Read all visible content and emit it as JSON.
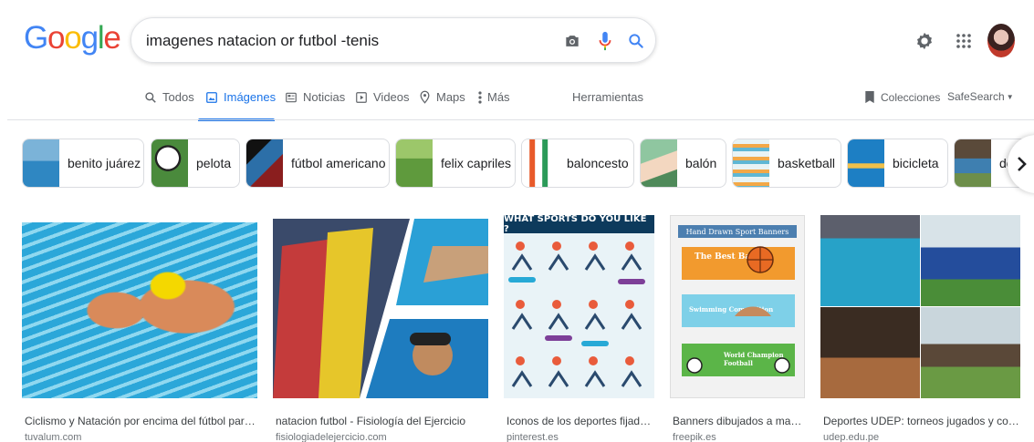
{
  "logo": "Google",
  "search": {
    "query": "imagenes natacion or futbol -tenis"
  },
  "icons": {
    "camera": "camera-icon",
    "mic": "mic-icon",
    "search": "search-icon",
    "settings": "gear-icon",
    "apps": "apps-grid-icon"
  },
  "tabs": [
    {
      "label": "Todos",
      "icon": "search-icon"
    },
    {
      "label": "Imágenes",
      "icon": "image-icon",
      "active": true
    },
    {
      "label": "Noticias",
      "icon": "news-icon"
    },
    {
      "label": "Videos",
      "icon": "video-icon"
    },
    {
      "label": "Maps",
      "icon": "pin-icon"
    },
    {
      "label": "Más",
      "icon": "more-vert-icon"
    }
  ],
  "tools_label": "Herramientas",
  "collections_label": "Colecciones",
  "safesearch_label": "SafeSearch",
  "chips": [
    {
      "label": "benito juárez"
    },
    {
      "label": "pelota"
    },
    {
      "label": "fútbol americano"
    },
    {
      "label": "felix capriles"
    },
    {
      "label": "baloncesto"
    },
    {
      "label": "balón"
    },
    {
      "label": "basketball"
    },
    {
      "label": "bicicleta"
    },
    {
      "label": "de"
    }
  ],
  "results": [
    {
      "title": "Ciclismo y Natación por encima del fútbol para much...",
      "source": "tuvalum.com"
    },
    {
      "title": "natacion futbol - Fisiología del Ejercicio",
      "source": "fisiologiadelejercicio.com"
    },
    {
      "title": "Iconos de los deportes fijados c...",
      "source": "pinterest.es",
      "image_text": "WHAT SPORTS DO YOU LIKE ?"
    },
    {
      "title": "Banners dibujados a mano d...",
      "source": "freepik.es",
      "image_text": [
        "Hand Drawn Sport Banners",
        "The Best Basket",
        "Swimming Competition",
        "World Champion Football"
      ]
    },
    {
      "title": "Deportes UDEP: torneos jugados y convocat...",
      "source": "udep.edu.pe"
    }
  ],
  "colors": {
    "accent": "#1a73e8",
    "text": "#202124",
    "muted": "#5f6368"
  }
}
